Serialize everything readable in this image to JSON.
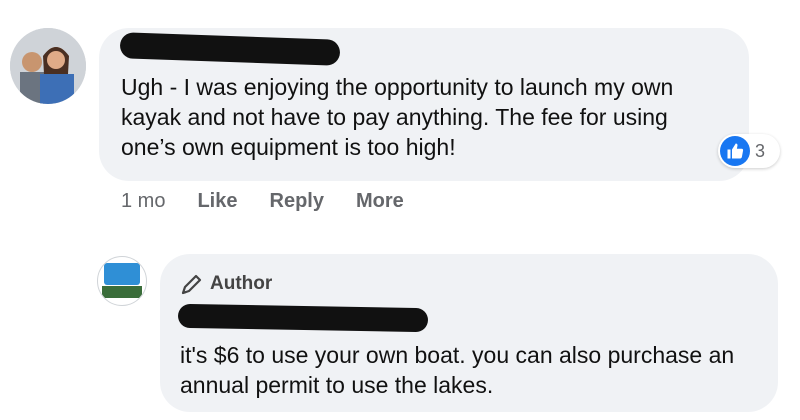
{
  "comment1": {
    "text": "Ugh - I was enjoying the opportunity to launch my own kayak and not have to pay anything. The fee for using one’s own equipment is too high!",
    "reaction_count": "3",
    "actions": {
      "time": "1 mo",
      "like": "Like",
      "reply": "Reply",
      "more": "More"
    }
  },
  "reply": {
    "badge": "Author",
    "text": "it's $6 to use your own boat. you can also purchase an annual permit to use the lakes."
  },
  "colors": {
    "bubble": "#f0f2f5",
    "like_blue": "#1877f2",
    "meta_gray": "#65676b"
  },
  "icons": [
    "avatar-icon",
    "like-icon",
    "pencil-icon",
    "page-logo-icon"
  ]
}
